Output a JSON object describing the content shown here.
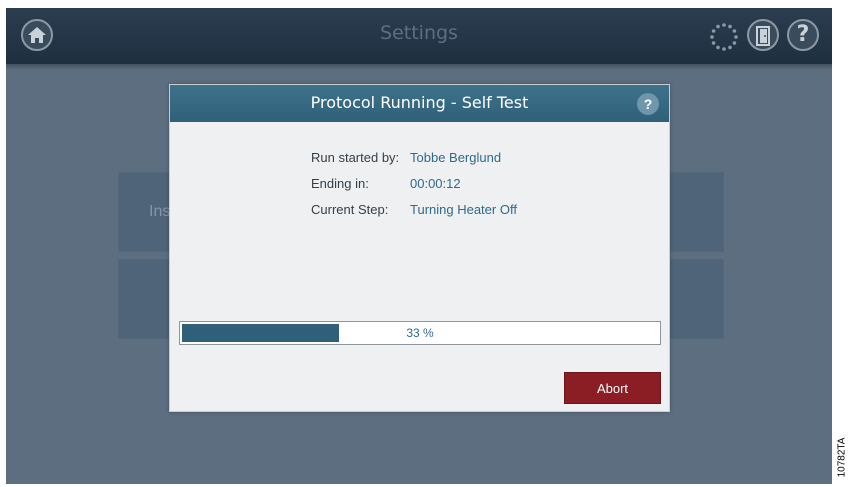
{
  "app": {
    "title": "Settings"
  },
  "topbar": {
    "home_icon": "home-icon",
    "status_icon": "spinner-icon",
    "door_icon": "door-icon",
    "help_label": "?"
  },
  "background": {
    "tile_partial_label": "Ins"
  },
  "dialog": {
    "title": "Protocol Running - Self Test",
    "help_label": "?",
    "fields": [
      {
        "label": "Run started by:",
        "value": "Tobbe Berglund"
      },
      {
        "label": "Ending in:",
        "value": "00:00:12"
      },
      {
        "label": "Current Step:",
        "value": "Turning Heater Off"
      }
    ],
    "progress": {
      "value": 0.33,
      "text": "33 %"
    },
    "abort_label": "Abort"
  },
  "colors": {
    "header": "#2f6079",
    "abort": "#8b1d24",
    "accent_text": "#2f6a8c"
  },
  "figure_tag": "10782TA"
}
